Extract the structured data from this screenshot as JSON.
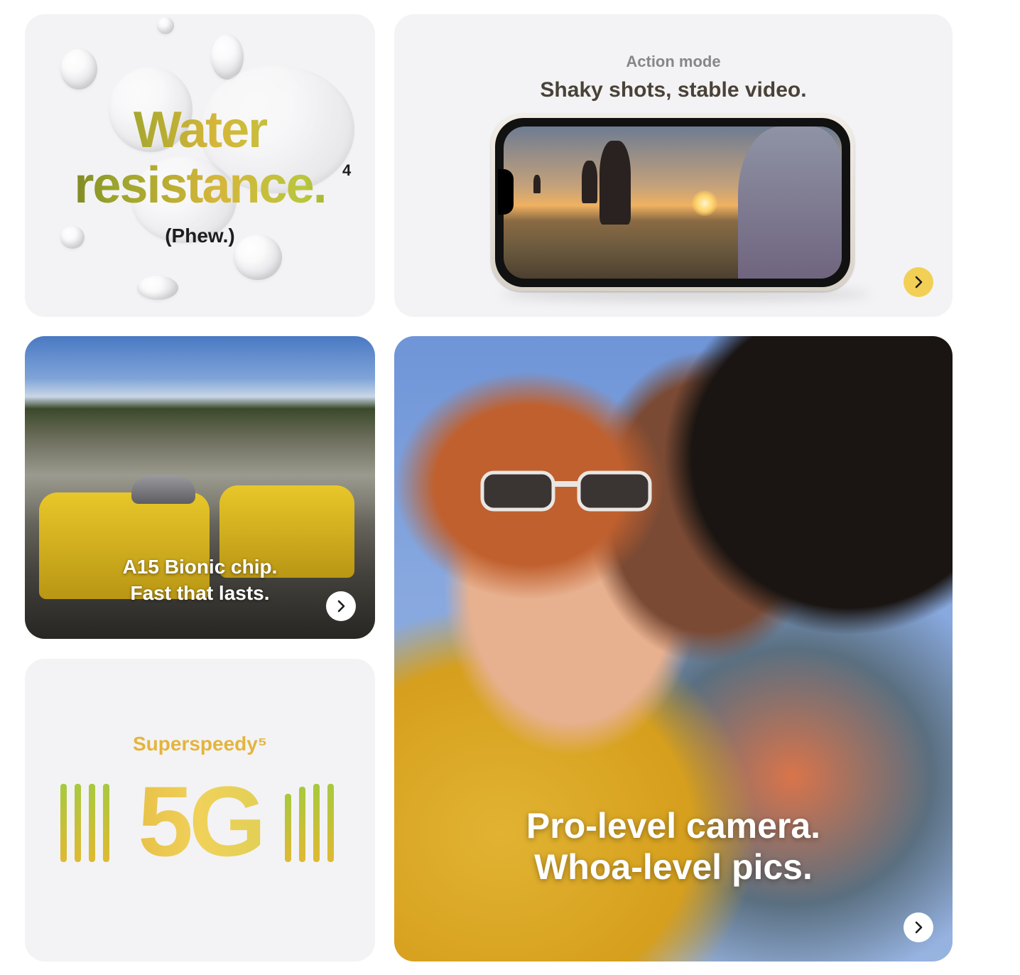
{
  "water": {
    "line1": "Water",
    "line2": "resistance.",
    "footnote": "4",
    "subtitle": "(Phew.)"
  },
  "action": {
    "eyebrow": "Action mode",
    "headline": "Shaky shots, stable video.",
    "arrow_icon": "chevron-right-icon"
  },
  "chip": {
    "line1": "A15 Bionic chip.",
    "line2": "Fast that lasts.",
    "arrow_icon": "chevron-right-icon"
  },
  "fiveg": {
    "eyebrow": "Superspeedy⁵",
    "big": "5G"
  },
  "camera": {
    "line1": "Pro-level camera.",
    "line2": "Whoa-level pics.",
    "arrow_icon": "chevron-right-icon"
  },
  "colors": {
    "tile_bg": "#f3f3f5",
    "accent_yellow": "#f2cf55",
    "eyebrow_gray": "#86868b",
    "superspeedy_gold": "#e4b43c"
  }
}
